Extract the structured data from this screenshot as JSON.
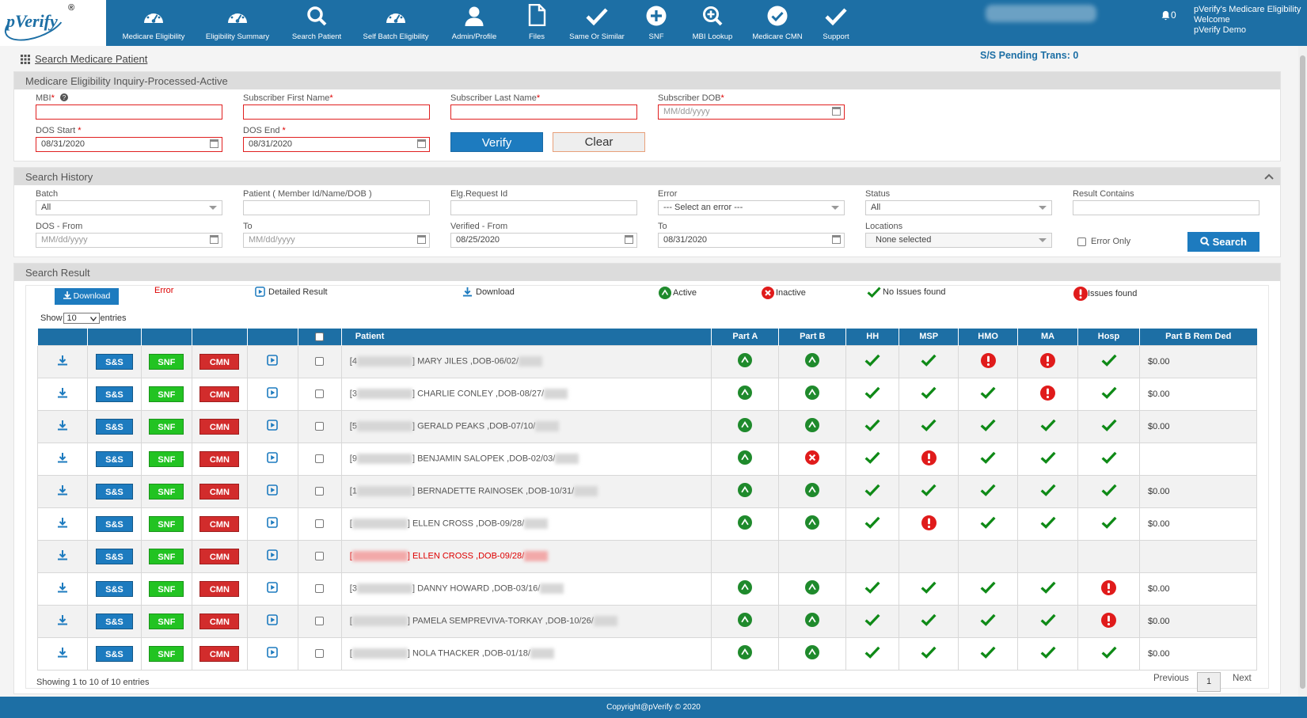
{
  "app": {
    "logo": "pVerify",
    "logo_mark": "®",
    "nav": [
      {
        "label": "Medicare Eligibility",
        "icon": "gauge-icon"
      },
      {
        "label": "Eligibility Summary",
        "icon": "gauge-icon"
      },
      {
        "label": "Search Patient",
        "icon": "search-icon"
      },
      {
        "label": "Self Batch Eligibility",
        "icon": "gauge-icon"
      },
      {
        "label": "Admin/Profile",
        "icon": "user-icon"
      },
      {
        "label": "Files",
        "icon": "file-icon"
      },
      {
        "label": "Same Or Similar",
        "icon": "check-icon"
      },
      {
        "label": "SNF",
        "icon": "plus-circle-icon"
      },
      {
        "label": "MBI Lookup",
        "icon": "zoom-in-icon"
      },
      {
        "label": "Medicare CMN",
        "icon": "check-circle-icon"
      },
      {
        "label": "Support",
        "icon": "check-icon"
      }
    ],
    "notification_count": "0",
    "user_line1": "pVerify's Medicare Eligibility",
    "user_line2": "Welcome",
    "user_line3": "pVerify Demo"
  },
  "page": {
    "title": "Search Medicare Patient",
    "pending": "S/S Pending Trans: 0"
  },
  "inquiry": {
    "heading": "Medicare Eligibility Inquiry-Processed-Active",
    "mbi_label": "MBI",
    "first_label": "Subscriber First Name",
    "last_label": "Subscriber Last Name",
    "dob_label": "Subscriber DOB",
    "dob_placeholder": "MM/dd/yyyy",
    "dos_start_label": "DOS Start ",
    "dos_start": "08/31/2020",
    "dos_end_label": "DOS End ",
    "dos_end": "08/31/2020",
    "verify_label": "Verify",
    "clear_label": "Clear"
  },
  "history": {
    "heading": "Search History",
    "batch_label": "Batch",
    "batch_value": "All",
    "patient_label": "Patient ( Member Id/Name/DOB )",
    "reqid_label": "Elg.Request Id",
    "error_label": "Error",
    "error_value": "--- Select an error ---",
    "status_label": "Status",
    "status_value": "All",
    "result_label": "Result Contains",
    "dos_from_label": "DOS - From",
    "dos_from_ph": "MM/dd/yyyy",
    "to_label": "To",
    "to_ph": "MM/dd/yyyy",
    "ver_from_label": "Verified - From",
    "ver_from": "08/25/2020",
    "ver_to_label": "To",
    "ver_to": "08/31/2020",
    "locations_label": "Locations",
    "locations_value": "None selected",
    "error_only_label": "Error Only",
    "search_label": "Search"
  },
  "results": {
    "heading": "Search Result",
    "download_btn": "Download",
    "legend_error": "Error",
    "legend_detailed": "Detailed Result",
    "legend_download": "Download",
    "legend_active": "Active",
    "legend_inactive": "Inactive",
    "legend_noissues": "No Issues found",
    "legend_issues": "Issues found",
    "show_label": "Show",
    "show_value": "10",
    "entries_label": "entries",
    "columns": [
      "Patient",
      "Part A",
      "Part B",
      "HH",
      "MSP",
      "HMO",
      "MA",
      "Hosp",
      "Part B Rem Ded"
    ],
    "btn_ss": "S&S",
    "btn_snf": "SNF",
    "btn_cmn": "CMN",
    "rows": [
      {
        "pid": "[4",
        "name": "] MARY JILES ,DOB-06/02/",
        "a": "active",
        "b": "active",
        "hh": "ok",
        "msp": "ok",
        "hmo": "issue",
        "ma": "issue",
        "hosp": "ok",
        "ded": "$0.00",
        "err": false
      },
      {
        "pid": "[3",
        "name": "] CHARLIE CONLEY ,DOB-08/27/",
        "a": "active",
        "b": "active",
        "hh": "ok",
        "msp": "ok",
        "hmo": "ok",
        "ma": "issue",
        "hosp": "ok",
        "ded": "$0.00",
        "err": false
      },
      {
        "pid": "[5",
        "name": "] GERALD PEAKS ,DOB-07/10/",
        "a": "active",
        "b": "active",
        "hh": "ok",
        "msp": "ok",
        "hmo": "ok",
        "ma": "ok",
        "hosp": "ok",
        "ded": "$0.00",
        "err": false
      },
      {
        "pid": "[9",
        "name": "] BENJAMIN SALOPEK ,DOB-02/03/",
        "a": "active",
        "b": "inactive",
        "hh": "ok",
        "msp": "issue",
        "hmo": "ok",
        "ma": "ok",
        "hosp": "ok",
        "ded": "",
        "err": false
      },
      {
        "pid": "[1",
        "name": "] BERNADETTE RAINOSEK ,DOB-10/31/",
        "a": "active",
        "b": "active",
        "hh": "ok",
        "msp": "ok",
        "hmo": "ok",
        "ma": "ok",
        "hosp": "ok",
        "ded": "$0.00",
        "err": false
      },
      {
        "pid": "[",
        "name": "] ELLEN CROSS ,DOB-09/28/",
        "a": "active",
        "b": "active",
        "hh": "ok",
        "msp": "issue",
        "hmo": "ok",
        "ma": "ok",
        "hosp": "ok",
        "ded": "$0.00",
        "err": false
      },
      {
        "pid": "[",
        "name": "] ELLEN CROSS ,DOB-09/28/",
        "a": "",
        "b": "",
        "hh": "",
        "msp": "",
        "hmo": "",
        "ma": "",
        "hosp": "",
        "ded": "",
        "err": true
      },
      {
        "pid": "[3",
        "name": "] DANNY HOWARD ,DOB-03/16/",
        "a": "active",
        "b": "active",
        "hh": "ok",
        "msp": "ok",
        "hmo": "ok",
        "ma": "ok",
        "hosp": "issue",
        "ded": "$0.00",
        "err": false
      },
      {
        "pid": "[",
        "name": "] PAMELA SEMPREVIVA-TORKAY ,DOB-10/26/",
        "a": "active",
        "b": "active",
        "hh": "ok",
        "msp": "ok",
        "hmo": "ok",
        "ma": "ok",
        "hosp": "issue",
        "ded": "$0.00",
        "err": false
      },
      {
        "pid": "[",
        "name": "] NOLA THACKER ,DOB-01/18/",
        "a": "active",
        "b": "active",
        "hh": "ok",
        "msp": "ok",
        "hmo": "ok",
        "ma": "ok",
        "hosp": "ok",
        "ded": "$0.00",
        "err": false
      }
    ],
    "showing": "Showing 1 to 10 of 10 entries",
    "previous": "Previous",
    "page": "1",
    "next": "Next"
  },
  "footer": "Copyright@pVerify © 2020",
  "colors": {
    "brand": "#1d6fa5",
    "button": "#1d7bbf",
    "ok": "#0f8a17",
    "issue": "#e01b1b",
    "active": "#1f8a2c"
  }
}
